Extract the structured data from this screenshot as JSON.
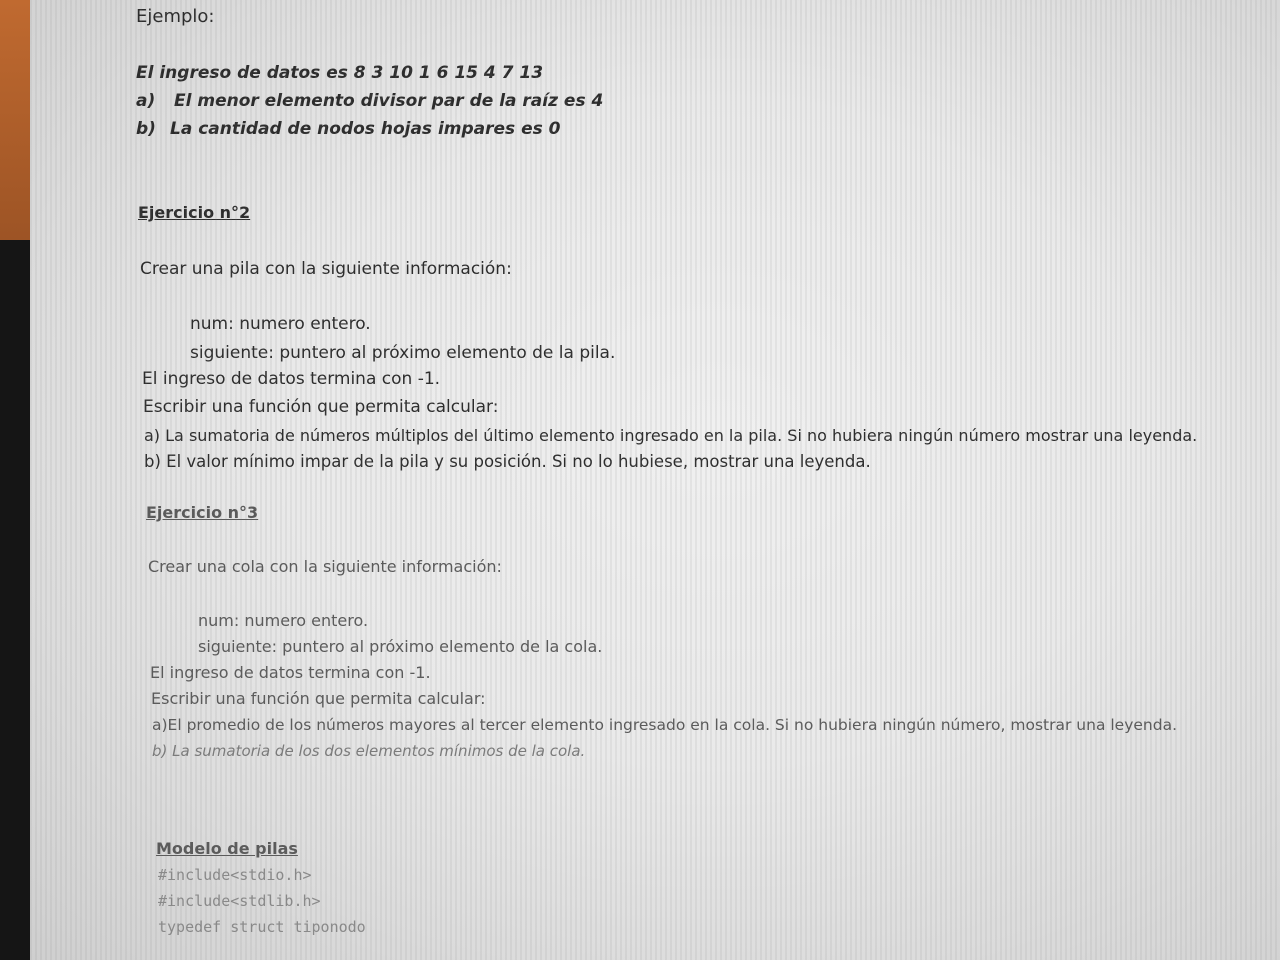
{
  "document": {
    "ejemplo_label": "Ejemplo:",
    "ejemplo_input": "El ingreso de datos es 8 3 10 1 6 15 4 7 13",
    "ejemplo_answers": [
      {
        "label": "a)",
        "text": "El menor elemento divisor par de la raíz es 4"
      },
      {
        "label": "b)",
        "text": "La cantidad de nodos hojas impares es 0"
      }
    ],
    "ejercicio2": {
      "heading": "Ejercicio n°2",
      "intro": "Crear una pila con la siguiente información:",
      "fields": [
        "num: numero entero.",
        "siguiente: puntero al próximo elemento de la pila."
      ],
      "end_condition": "El ingreso de datos termina con -1.",
      "task_intro": "Escribir una función que permita calcular:",
      "tasks": [
        "a) La sumatoria de números múltiplos del último elemento ingresado en la pila. Si no hubiera ningún número mostrar una leyenda.",
        "b) El valor mínimo impar de la pila y su posición. Si no lo hubiese, mostrar una leyenda."
      ]
    },
    "ejercicio3": {
      "heading": "Ejercicio n°3",
      "intro": "Crear una cola con la siguiente información:",
      "fields": [
        "num: numero entero.",
        "siguiente: puntero al próximo elemento de la cola."
      ],
      "end_condition": "El ingreso de datos termina con -1.",
      "task_intro": "Escribir una función que permita calcular:",
      "tasks": [
        "a)El promedio de los números mayores al tercer elemento ingresado en la cola. Si no hubiera ningún número, mostrar una leyenda.",
        "b) La sumatoria de los dos elementos mínimos de la cola."
      ]
    },
    "modelo": {
      "heading": "Modelo de pilas",
      "code_lines": [
        "#include<stdio.h>",
        "#include<stdlib.h>",
        "typedef struct tiponodo"
      ]
    }
  }
}
